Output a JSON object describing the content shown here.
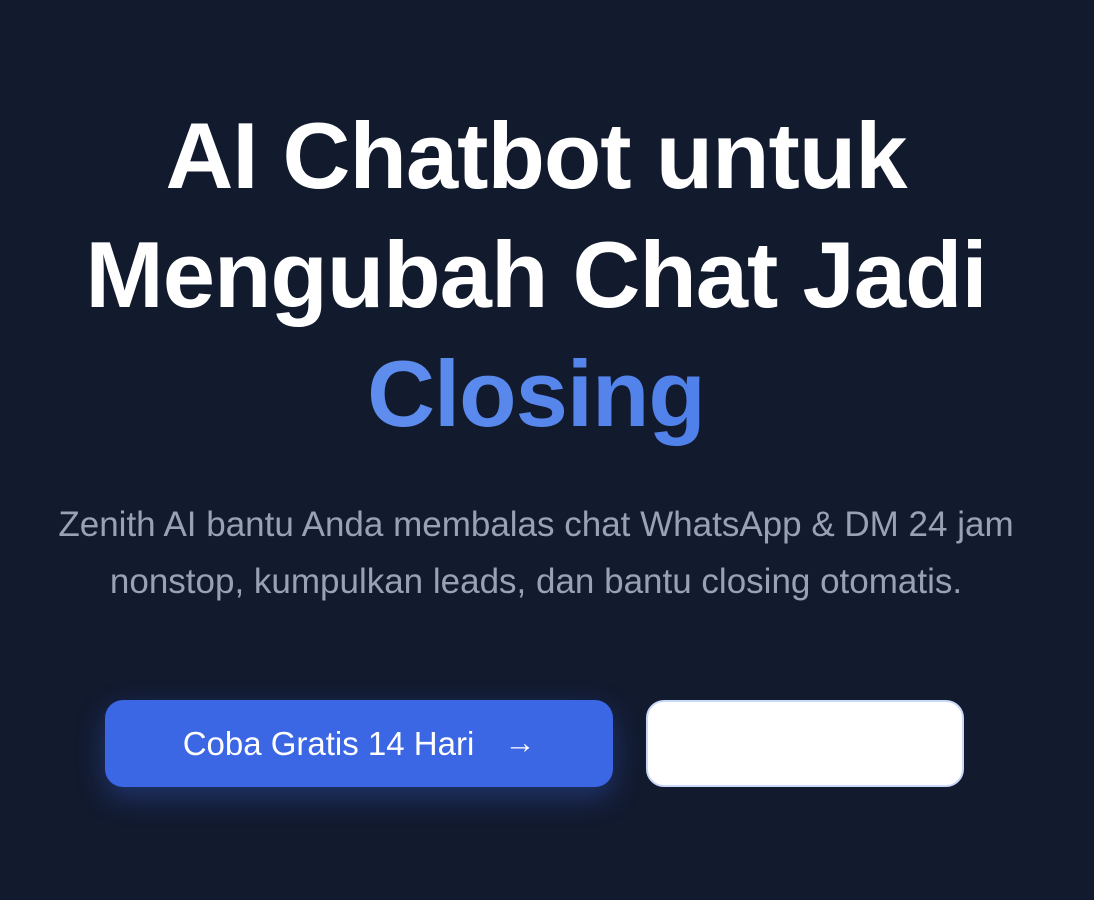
{
  "hero": {
    "headline_line1": "AI Chatbot untuk",
    "headline_line2": "Mengubah Chat Jadi",
    "headline_accent": "Closing",
    "subtitle_line1": "Zenith AI bantu Anda membalas chat WhatsApp & DM 24 jam",
    "subtitle_line2": "nonstop, kumpulkan leads, dan bantu closing otomatis."
  },
  "actions": {
    "primary_label": "Coba Gratis 14 Hari",
    "primary_icon": "arrow-right-icon",
    "secondary_label": ""
  },
  "colors": {
    "background": "#121a2e",
    "accent_gradient_start": "#6f9cf2",
    "accent_gradient_end": "#3f72e6",
    "primary_button": "#3b66e4",
    "subtitle_text": "#98a2b3"
  }
}
